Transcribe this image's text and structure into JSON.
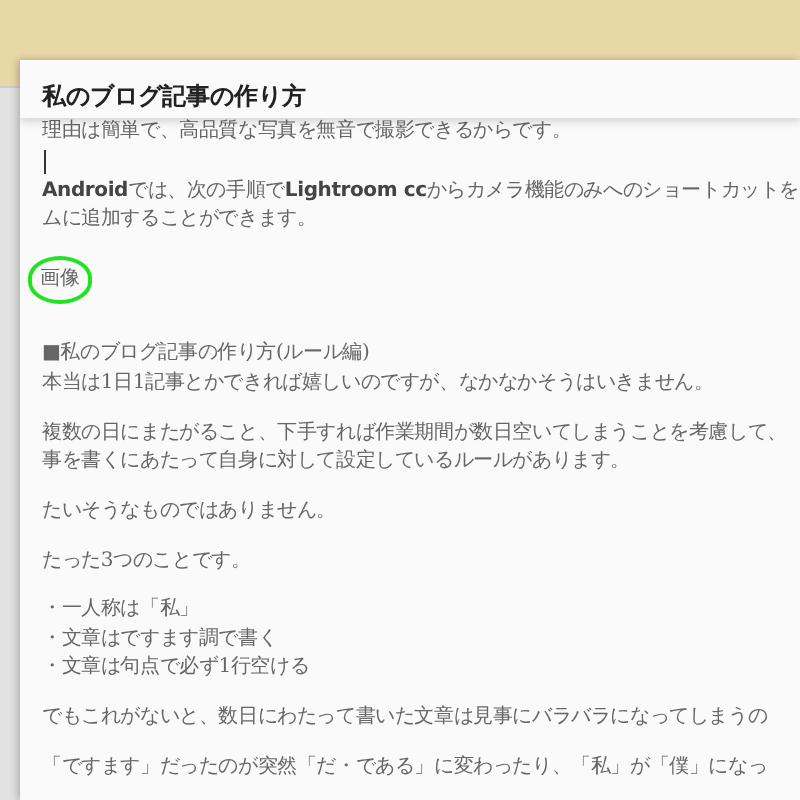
{
  "dialog": {
    "title": "私のブログ記事の作り方"
  },
  "body": [
    {
      "kind": "paragraph",
      "lines": [
        "理由は簡単で、高品質な写真を無音で撮影できるからです。"
      ]
    },
    {
      "kind": "cursor"
    },
    {
      "kind": "paragraph",
      "lines": [
        "**Android**では、次の手順で**Lightroom cc**からカメラ機能のみへのショートカットを",
        "ムに追加することができます。"
      ]
    },
    {
      "kind": "circled",
      "lines": [
        "画像"
      ]
    },
    {
      "kind": "paragraph",
      "lines": [
        "■私のブログ記事の作り方(ルール編)",
        "本当は1日1記事とかできれば嬉しいのですが、なかなかそうはいきません。"
      ]
    },
    {
      "kind": "paragraph",
      "lines": [
        "複数の日にまたがること、下手すれば作業期間が数日空いてしまうことを考慮して、",
        "事を書くにあたって自身に対して設定しているルールがあります。"
      ]
    },
    {
      "kind": "paragraph",
      "lines": [
        "たいそうなものではありません。"
      ]
    },
    {
      "kind": "paragraph",
      "lines": [
        "たった3つのことです。"
      ]
    },
    {
      "kind": "paragraph",
      "lines": [
        "・一人称は「私」",
        "・文章はですます調で書く",
        "・文章は句点で必ず1行空ける"
      ]
    },
    {
      "kind": "paragraph",
      "lines": [
        "でもこれがないと、数日にわたって書いた文章は見事にバラバラになってしまうの"
      ]
    },
    {
      "kind": "paragraph",
      "lines": [
        "「ですます」だったのが突然「だ・である」に変わったり、「私」が「僕」になっ"
      ]
    }
  ]
}
